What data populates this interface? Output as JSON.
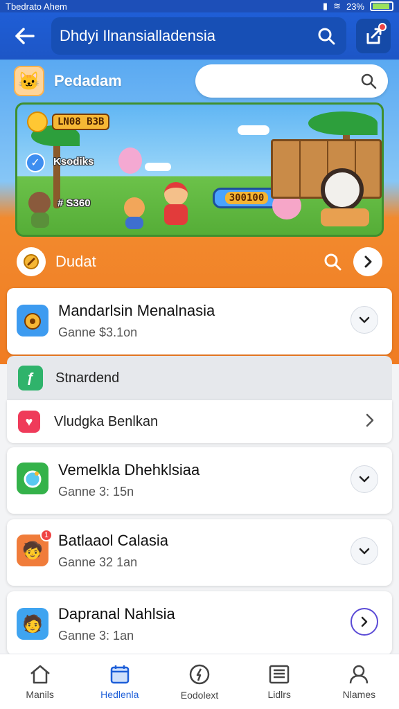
{
  "status_bar": {
    "left_text": "Tbedrato Ahem",
    "battery": "23%"
  },
  "app_bar": {
    "title": "Dhdyi Ilnansialladensia"
  },
  "hero": {
    "profile_name": "Pedadam",
    "search_placeholder": "",
    "banner": {
      "top_score": "LN08 B3B",
      "mode_label": "Ksodiks",
      "left_score": "# S360",
      "pill_score": "300100"
    },
    "section_label": "Dudat"
  },
  "cards": [
    {
      "title": "Mandarlsin Menalnasia",
      "subtitle": "Ganne $3.1on"
    },
    {
      "title": "Vemelkla Dhehklsiaa",
      "subtitle": "Ganne 3: 15n"
    },
    {
      "title": "Batlaaol Calasia",
      "subtitle": "Ganne 32 1an",
      "badge": "1"
    },
    {
      "title": "Dapranal Nahlsia",
      "subtitle": "Ganne 3: 1an"
    }
  ],
  "section": {
    "label": "Stnardend"
  },
  "row": {
    "label": "Vludgka Benlkan"
  },
  "bottom_nav": [
    {
      "label": "Manils",
      "icon": "home-icon"
    },
    {
      "label": "Hedlenla",
      "icon": "calendar-icon",
      "active": true
    },
    {
      "label": "Eodolext",
      "icon": "compass-icon"
    },
    {
      "label": "Lidlrs",
      "icon": "newspaper-icon"
    },
    {
      "label": "Nlames",
      "icon": "person-icon"
    }
  ],
  "colors": {
    "primary": "#1f5ed6",
    "accent": "#f07c22",
    "active_nav": "#1d5ed8"
  }
}
